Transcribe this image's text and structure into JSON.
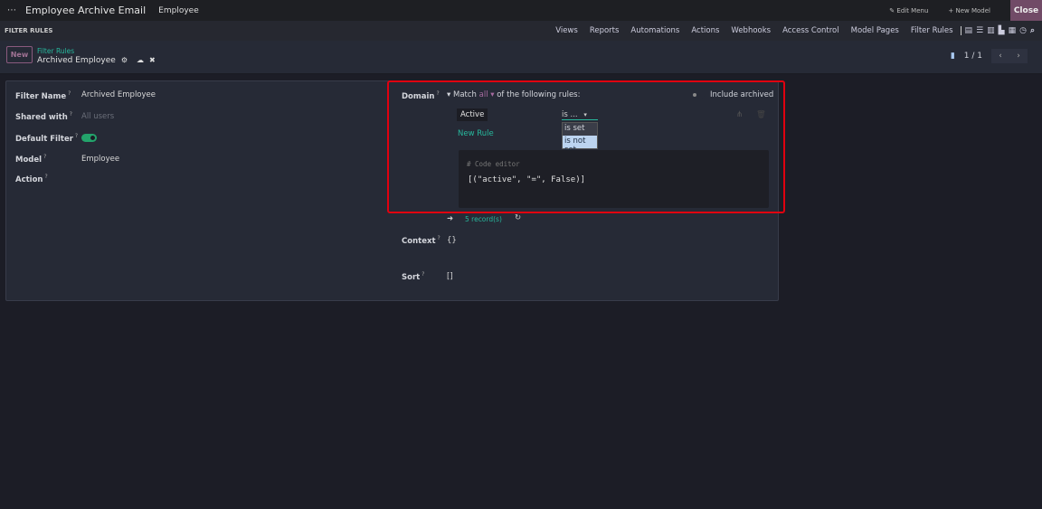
{
  "navbar": {
    "app_title": "Employee Archive Email",
    "menu": "Employee",
    "edit_menu": "Edit Menu",
    "new_model": "+ New Model",
    "close": "Close"
  },
  "subnav": {
    "label": "FILTER RULES",
    "items": [
      "Views",
      "Reports",
      "Automations",
      "Actions",
      "Webhooks",
      "Access Control",
      "Model Pages",
      "Filter Rules"
    ]
  },
  "control": {
    "new": "New",
    "breadcrumb_parent": "Filter Rules",
    "breadcrumb_current": "Archived Employee",
    "pager": "1 / 1"
  },
  "form": {
    "filter_name_label": "Filter Name",
    "filter_name": "Archived Employee",
    "shared_with_label": "Shared with",
    "shared_with_placeholder": "All users",
    "default_filter_label": "Default Filter",
    "default_filter": true,
    "model_label": "Model",
    "model": "Employee",
    "action_label": "Action",
    "domain_label": "Domain",
    "match_prefix": "Match",
    "match_value": "all",
    "match_suffix": "of the following rules:",
    "include_archived": "Include archived",
    "rule_field": "Active",
    "rule_operator": "is ...",
    "operator_options": [
      "is set",
      "is not set"
    ],
    "new_rule": "New Rule",
    "code_comment": "# Code editor",
    "code": "[(\"active\", \"=\", False)]",
    "records": "5 record(s)",
    "context_label": "Context",
    "context": "{}",
    "sort_label": "Sort",
    "sort": "[]"
  }
}
